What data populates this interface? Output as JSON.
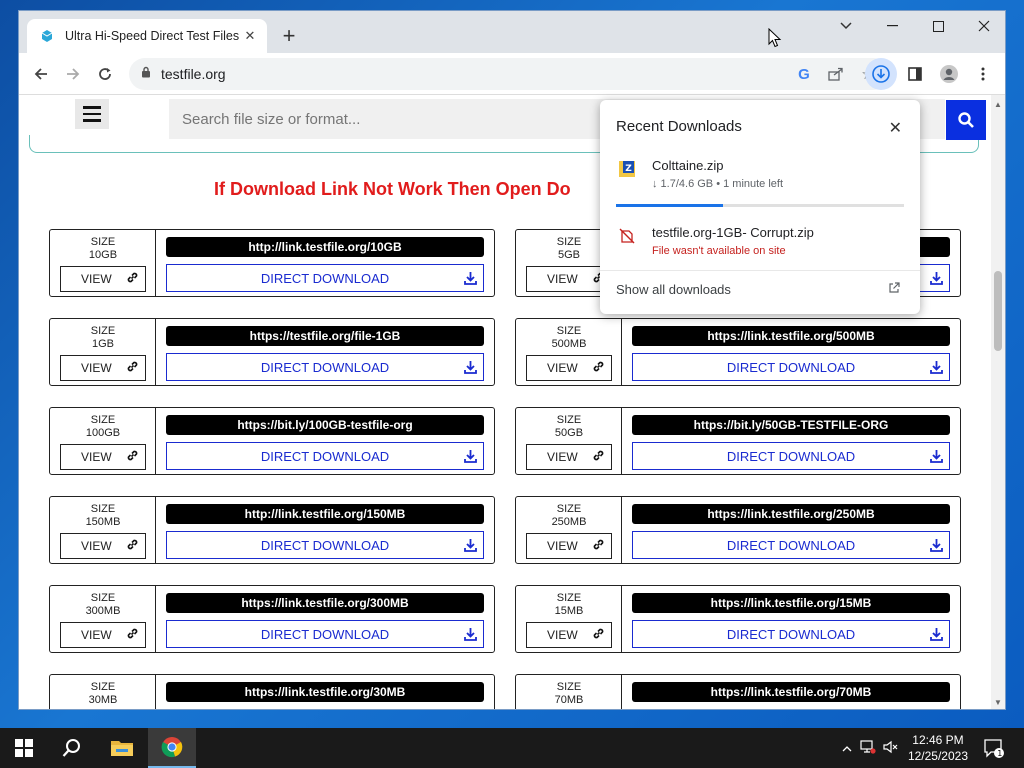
{
  "browser": {
    "tab_title": "Ultra Hi-Speed Direct Test Files D",
    "url": "testfile.org"
  },
  "site": {
    "search_placeholder": "Search file size or format...",
    "notice": "If Download Link Not Work Then Open Do"
  },
  "cards": [
    {
      "size_label": "SIZE",
      "size": "10GB",
      "link": "http://link.testfile.org/10GB",
      "view": "VIEW",
      "download": "DIRECT DOWNLOAD"
    },
    {
      "size_label": "SIZE",
      "size": "5GB",
      "link": "",
      "view": "VIEW",
      "download": "DIRECT DOWNLOAD"
    },
    {
      "size_label": "SIZE",
      "size": "1GB",
      "link": "https://testfile.org/file-1GB",
      "view": "VIEW",
      "download": "DIRECT DOWNLOAD"
    },
    {
      "size_label": "SIZE",
      "size": "500MB",
      "link": "https://link.testfile.org/500MB",
      "view": "VIEW",
      "download": "DIRECT DOWNLOAD"
    },
    {
      "size_label": "SIZE",
      "size": "100GB",
      "link": "https://bit.ly/100GB-testfile-org",
      "view": "VIEW",
      "download": "DIRECT DOWNLOAD"
    },
    {
      "size_label": "SIZE",
      "size": "50GB",
      "link": "https://bit.ly/50GB-TESTFILE-ORG",
      "view": "VIEW",
      "download": "DIRECT DOWNLOAD"
    },
    {
      "size_label": "SIZE",
      "size": "150MB",
      "link": "http://link.testfile.org/150MB",
      "view": "VIEW",
      "download": "DIRECT DOWNLOAD"
    },
    {
      "size_label": "SIZE",
      "size": "250MB",
      "link": "https://link.testfile.org/250MB",
      "view": "VIEW",
      "download": "DIRECT DOWNLOAD"
    },
    {
      "size_label": "SIZE",
      "size": "300MB",
      "link": "https://link.testfile.org/300MB",
      "view": "VIEW",
      "download": "DIRECT DOWNLOAD"
    },
    {
      "size_label": "SIZE",
      "size": "15MB",
      "link": "https://link.testfile.org/15MB",
      "view": "VIEW",
      "download": "DIRECT DOWNLOAD"
    },
    {
      "size_label": "SIZE",
      "size": "30MB",
      "link": "https://link.testfile.org/30MB",
      "view": "VIEW",
      "download": "DIRECT DOWNLOAD"
    },
    {
      "size_label": "SIZE",
      "size": "70MB",
      "link": "https://link.testfile.org/70MB",
      "view": "VIEW",
      "download": "DIRECT DOWNLOAD"
    }
  ],
  "downloads_popup": {
    "title": "Recent Downloads",
    "items": [
      {
        "name": "Colttaine.zip",
        "status": "↓ 1.7/4.6 GB • 1 minute left",
        "progress": 0.37
      },
      {
        "name": "testfile.org-1GB- Corrupt.zip",
        "status": "File wasn't available on site"
      }
    ],
    "show_all": "Show all downloads"
  },
  "taskbar": {
    "time": "12:46 PM",
    "date": "12/25/2023",
    "notification_count": "1"
  }
}
